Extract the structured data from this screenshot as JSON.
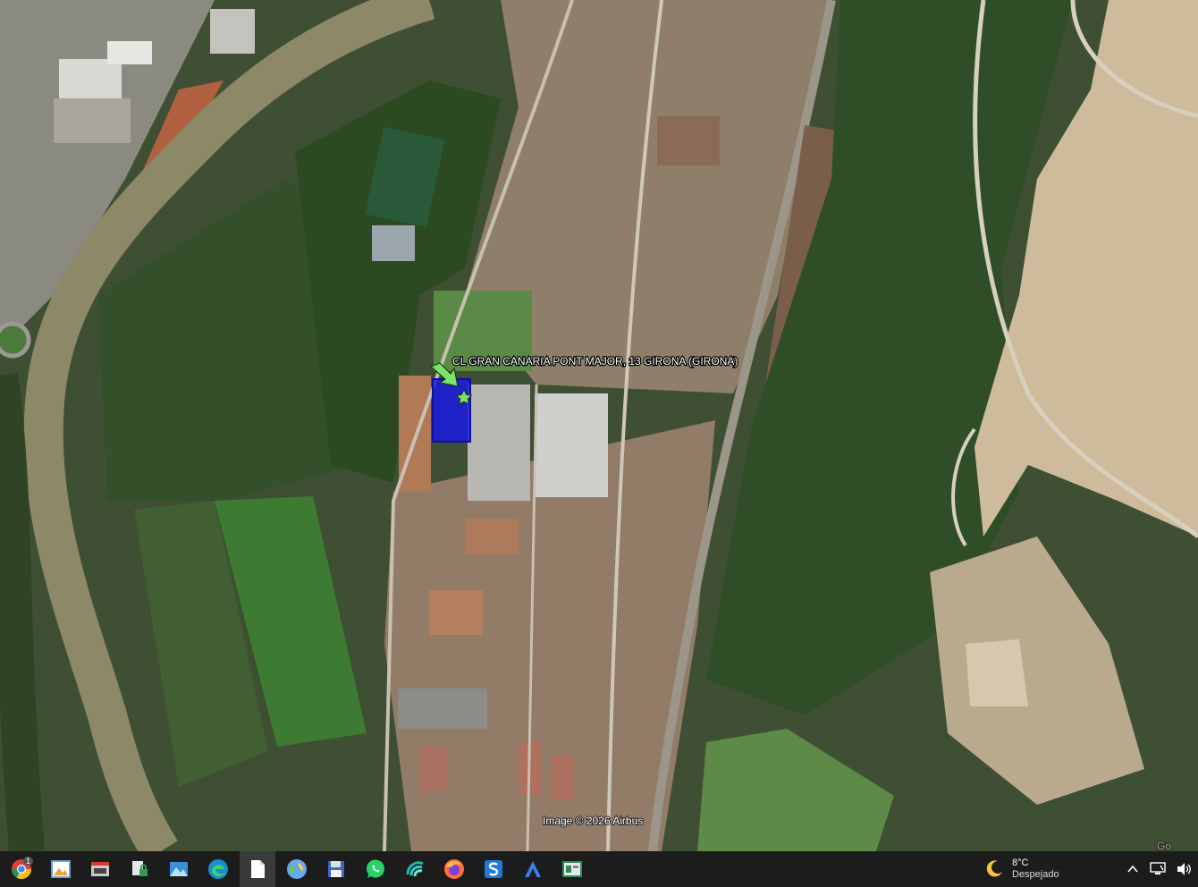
{
  "map": {
    "place_label": "CL GRAN CANARIA PONT MAJOR, 13  GIRONA (GIRONA)",
    "attribution": "Image © 2026 Airbus",
    "corner_text": "Go",
    "parcel_color": "#1a1ae0",
    "marker_color": "#7be36a"
  },
  "taskbar": {
    "chrome_badge": "1",
    "weather_temp": "8°C",
    "weather_desc": "Despejado"
  }
}
